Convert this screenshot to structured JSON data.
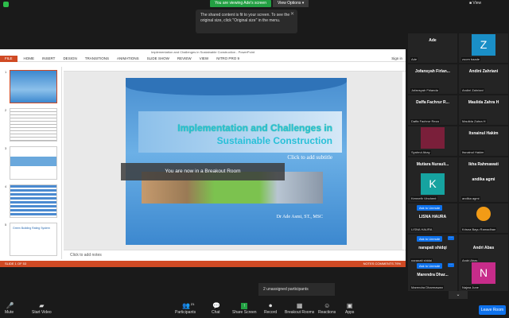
{
  "topbar": {
    "viewing_text": "You are viewing Ade's screen",
    "view_options": "View Options ▾",
    "view_control": "■ View"
  },
  "tooltip": {
    "text": "The shared content is fit to your screen. To see the original size, click \"Original size\" in the menu.",
    "close": "✕"
  },
  "ppt": {
    "window_title": "Implementation and Challenges in Sustainable Construction - PowerPoint",
    "ribbon": [
      "FILE",
      "HOME",
      "INSERT",
      "DESIGN",
      "TRANSITIONS",
      "ANIMATIONS",
      "SLIDE SHOW",
      "REVIEW",
      "VIEW",
      "NITRO PRO 9"
    ],
    "sign_in": "Sign in",
    "thumb_numbers": [
      "1",
      "2",
      "3",
      "4",
      "5"
    ],
    "thumb5_title": "Green Building Rating System",
    "slide": {
      "title_line1": "Implementation and Challenges in",
      "title_line2": "Sustainable Construction",
      "subtitle": "Click to add subtitle",
      "author": "Dr Ade Asmi, ST., MSC"
    },
    "notes_placeholder": "Click to add notes",
    "status_left": "SLIDE 1 OF 53",
    "status_right": "NOTES   COMMENTS   79%"
  },
  "breakout_message": "You are now in a Breakout Room",
  "participants": [
    {
      "name": "Ade",
      "label": "Ade",
      "avatar": "",
      "color": ""
    },
    {
      "name": "",
      "label": "zoom baade",
      "avatar": "Z",
      "color": "#1a8fc7"
    },
    {
      "name": "Jofansyah Firlan...",
      "label": "Jofansyah Firlanda",
      "avatar": "",
      "color": ""
    },
    {
      "name": "Andini Zahriani",
      "label": "Andini Zahriani",
      "avatar": "",
      "color": ""
    },
    {
      "name": "Daffa Fachrur R...",
      "label": "Daffa Fachrur Reza",
      "avatar": "",
      "color": ""
    },
    {
      "name": "Maulida Zahra H",
      "label": "Maulida Zahra H",
      "avatar": "",
      "color": ""
    },
    {
      "name": "",
      "label": "Syahrul Abay",
      "avatar": "",
      "color": ""
    },
    {
      "name": "Itsnainul Hakim",
      "label": "Itsnainul Hakim",
      "avatar": "",
      "color": ""
    },
    {
      "name": "Mutiara Nurauli...",
      "label": "Mutiara Nuraulia R",
      "avatar": "",
      "color": ""
    },
    {
      "name": "Ikha Rahmawati",
      "label": "Ikha Rahmawati",
      "avatar": "",
      "color": ""
    },
    {
      "name": "",
      "label": "Kenneth Vinchent",
      "avatar": "K",
      "color": "#16a3a0"
    },
    {
      "name": "andika agmi",
      "label": "andika agmi",
      "avatar": "",
      "color": ""
    },
    {
      "name": "LISNA HAURA",
      "label": "LISNA HAURA",
      "avatar": "",
      "color": ""
    },
    {
      "name": "",
      "label": "Krisna Bayu Ramadhan",
      "avatar": "",
      "color": ""
    },
    {
      "name": "narapati shidqi",
      "label": "narapati shidqi",
      "avatar": "",
      "color": ""
    },
    {
      "name": "Andri Abas",
      "label": "Andri Abas",
      "avatar": "",
      "color": ""
    },
    {
      "name": "Marendra Dhar...",
      "label": "Marendra Dharmawan",
      "avatar": "",
      "color": ""
    },
    {
      "name": "",
      "label": "Najwa June",
      "avatar": "N",
      "color": "#c72c8a"
    }
  ],
  "ask_unmute": "Ask to Unmute",
  "unassigned": "2 unassigned participants",
  "down_arrow": "⌄",
  "toolbar": {
    "mute": "Mute",
    "start_video": "Start Video",
    "participants": "Participants",
    "participants_count": "21",
    "chat": "Chat",
    "share_screen": "Share Screen",
    "record": "Record",
    "breakout_rooms": "Breakout Rooms",
    "reactions": "Reactions",
    "apps": "Apps",
    "leave": "Leave Room"
  },
  "colors": {
    "accent": "#0e71eb",
    "ppt_orange": "#d04a24",
    "zoom_green": "#23a043"
  }
}
